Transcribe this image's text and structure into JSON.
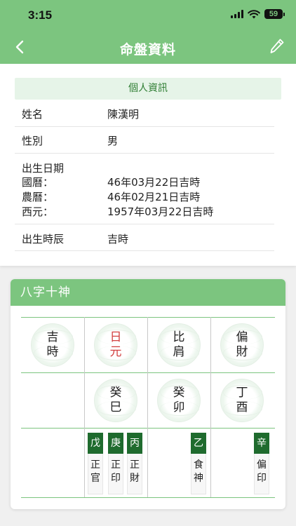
{
  "status_bar": {
    "time": "3:15",
    "battery": "59"
  },
  "nav": {
    "title": "命盤資料",
    "back_icon": "chevron-left-icon",
    "edit_icon": "pencil-icon"
  },
  "colors": {
    "primary": "#7cc57f",
    "dark_green": "#1f6b2e",
    "accent_red": "#d23f3f",
    "section_bg": "#e6f4e8"
  },
  "personal": {
    "section_title": "個人資訊",
    "name_label": "姓名",
    "name": "陳漢明",
    "gender_label": "性別",
    "gender": "男",
    "birth_label": "出生日期",
    "birth": [
      {
        "label": "國曆：",
        "value": "46年03月22日吉時"
      },
      {
        "label": "農曆：",
        "value": "46年02月21日吉時"
      },
      {
        "label": "西元：",
        "value": "1957年03月22日吉時"
      }
    ],
    "hour_label": "出生時辰",
    "hour": "吉時"
  },
  "bazi": {
    "title": "八字十神",
    "row1": [
      {
        "c1": "吉",
        "c2": "時"
      },
      {
        "c1": "日",
        "c2": "元"
      },
      {
        "c1": "比",
        "c2": "肩"
      },
      {
        "c1": "偏",
        "c2": "財"
      }
    ],
    "row2": [
      {
        "c1": "癸",
        "c2": "巳"
      },
      {
        "c1": "癸",
        "c2": "卯"
      },
      {
        "c1": "丁",
        "c2": "酉"
      }
    ],
    "row3": [
      {
        "stem": "戊",
        "god1": "正",
        "god2": "官"
      },
      {
        "stem": "庚",
        "god1": "正",
        "god2": "印"
      },
      {
        "stem": "丙",
        "god1": "正",
        "god2": "財"
      },
      {
        "stem": "乙",
        "god1": "食",
        "god2": "神"
      },
      {
        "stem": "辛",
        "god1": "偏",
        "god2": "印"
      }
    ]
  }
}
